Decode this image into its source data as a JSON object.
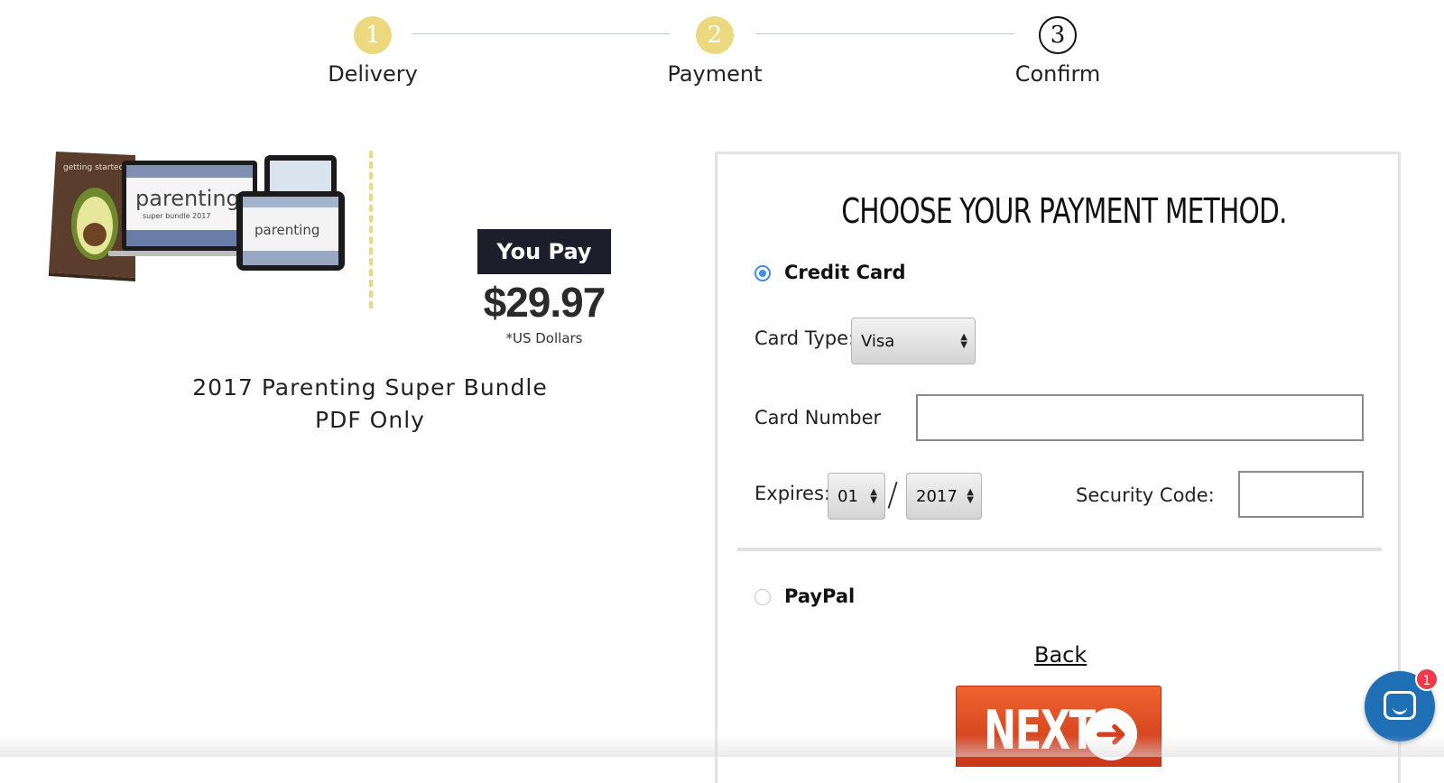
{
  "stepper": {
    "steps": [
      {
        "number": "1",
        "label": "Delivery"
      },
      {
        "number": "2",
        "label": "Payment"
      },
      {
        "number": "3",
        "label": "Confirm"
      }
    ],
    "completed_color": "#ecd97f"
  },
  "product": {
    "image_icon": "product-bundle-image",
    "image_text_top": "getting started",
    "image_text_main": "parenting",
    "image_text_sub": "super bundle 2017",
    "you_pay_label": "You Pay",
    "price": "$29.97",
    "currency_note": "*US Dollars",
    "name_line1": "2017 Parenting Super Bundle",
    "name_line2": "PDF Only"
  },
  "payment": {
    "title": "CHOOSE YOUR PAYMENT METHOD.",
    "credit_card_label": "Credit Card",
    "card_type_label": "Card Type:",
    "card_type_value": "Visa",
    "card_number_label": "Card Number",
    "card_number_value": "",
    "expires_label": "Expires:",
    "expires_month": "01",
    "expires_separator": "/",
    "expires_year": "2017",
    "security_code_label": "Security Code:",
    "security_code_value": "",
    "paypal_label": "PayPal",
    "back_label": "Back",
    "next_label": "NEXT",
    "accent_color": "#3b8ef0",
    "next_color": "#e64a24"
  },
  "chat": {
    "badge_count": "1",
    "icon": "chat-icon"
  }
}
